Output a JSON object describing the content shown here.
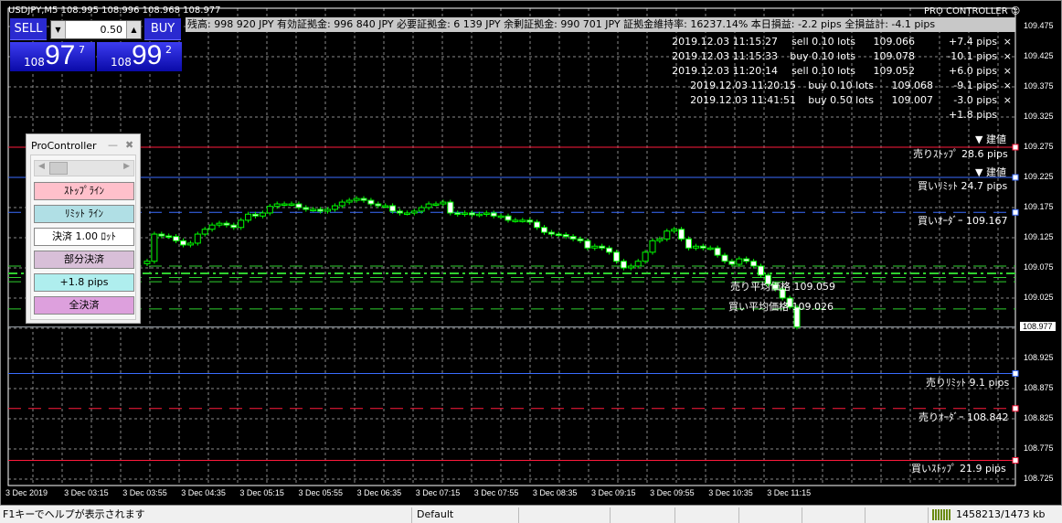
{
  "chart_header": {
    "symbol_line": "USDJPY,M5  108.995 108.996 108.968 108.977",
    "brand": "PRO CONTROLLER ☺"
  },
  "info_bar": "残高: 998 920 JPY   有効証拠金: 996 840 JPY   必要証拠金: 6 139 JPY   余剰証拠金: 990 701 JPY   証拠金維持率: 16237.14%   本日損益: -2.2 pips   全損益計: -4.1 pips",
  "trade_panel": {
    "sell_label": "SELL",
    "buy_label": "BUY",
    "lot": "0.50",
    "sell_price": {
      "prefix": "108",
      "main": "97",
      "sup": "7"
    },
    "buy_price": {
      "prefix": "108",
      "main": "99",
      "sup": "2"
    }
  },
  "positions": [
    {
      "time": "2019.12.03 11:15:27",
      "type": "sell 0.10 lots",
      "price": "109.066",
      "pips": "+7.4 pips",
      "close": "×"
    },
    {
      "time": "2019.12.03 11:15:33",
      "type": "buy 0.10 lots",
      "price": "109.078",
      "pips": "-10.1 pips",
      "close": "×"
    },
    {
      "time": "2019.12.03 11:20:14",
      "type": "sell 0.10 lots",
      "price": "109.052",
      "pips": "+6.0 pips",
      "close": "×"
    },
    {
      "time": "2019.12.03 11:20:15",
      "type": "buy 0.10 lots",
      "price": "109.068",
      "pips": "-9.1 pips",
      "close": "×"
    },
    {
      "time": "2019.12.03 11:41:51",
      "type": "buy 0.50 lots",
      "price": "109.007",
      "pips": "-3.0 pips",
      "close": "×"
    }
  ],
  "positions_total": "+1.8 pips",
  "procontroller": {
    "title": "ProController",
    "minimize": "—",
    "close": "✖",
    "buttons": [
      {
        "label": "ｽﾄｯﾌﾟﾗｲﾝ",
        "color": "#ffc0cb"
      },
      {
        "label": "ﾘﾐｯﾄ ﾗｲﾝ",
        "color": "#b0dfe5"
      },
      {
        "label": "決済 1.00 ﾛｯﾄ",
        "color": "#ffffff"
      },
      {
        "label": "部分決済",
        "color": "#d8bfd8"
      },
      {
        "label": "+1.8 pips",
        "color": "#afeeee"
      },
      {
        "label": "全決済",
        "color": "#dda0dd"
      }
    ]
  },
  "line_labels": {
    "entry1": "▼ 建値",
    "sell_stop": "売りｽﾄｯﾌﾟ 28.6 pips",
    "entry2": "▼ 建値",
    "buy_limit": "買いﾘﾐｯﾄ 24.7 pips",
    "buy_order": "買いｵｰﾀﾞｰ 109.167",
    "sell_avg": "売り平均価格 109.059",
    "buy_avg": "買い平均価格 109.026",
    "sell_limit": "売りﾘﾐｯﾄ 9.1 pips",
    "sell_order": "売りｵｰﾀﾞｰ 108.842",
    "buy_stop": "買いｽﾄｯﾌﾟ 21.9 pips"
  },
  "price_axis": [
    "109.475",
    "109.425",
    "109.375",
    "109.325",
    "109.275",
    "109.225",
    "109.175",
    "109.125",
    "109.075",
    "109.025",
    "108.975",
    "108.925",
    "108.875",
    "108.825",
    "108.775",
    "108.725"
  ],
  "current_price": "108.977",
  "time_axis": [
    "3 Dec 2019",
    "3 Dec 03:15",
    "3 Dec 03:55",
    "3 Dec 04:35",
    "3 Dec 05:15",
    "3 Dec 05:55",
    "3 Dec 06:35",
    "3 Dec 07:15",
    "3 Dec 07:55",
    "3 Dec 08:35",
    "3 Dec 09:15",
    "3 Dec 09:55",
    "3 Dec 10:35",
    "3 Dec 11:15"
  ],
  "status": {
    "help": "F1キーでヘルプが表示されます",
    "profile": "Default",
    "memory": "1458213/1473 kb"
  },
  "colors": {
    "bull": "#00ff00",
    "grid": "#a0a0a0",
    "stop": "#ff1a3c",
    "limit": "#3a6dff"
  },
  "chart_data": {
    "type": "candlestick",
    "closes": [
      109.086,
      109.131,
      109.128,
      109.127,
      109.12,
      109.113,
      109.116,
      109.131,
      109.139,
      109.146,
      109.149,
      109.146,
      109.142,
      109.154,
      109.164,
      109.161,
      109.166,
      109.177,
      109.181,
      109.181,
      109.181,
      109.175,
      109.172,
      109.172,
      109.169,
      109.172,
      109.178,
      109.184,
      109.187,
      109.19,
      109.187,
      109.181,
      109.178,
      109.178,
      109.169,
      109.166,
      109.166,
      109.169,
      109.175,
      109.181,
      109.181,
      109.184,
      109.166,
      109.164,
      109.166,
      109.163,
      109.164,
      109.166,
      109.161,
      109.161,
      109.154,
      109.154,
      109.154,
      109.151,
      109.142,
      109.134,
      109.131,
      109.13,
      109.127,
      109.123,
      109.12,
      109.108,
      109.111,
      109.108,
      109.101,
      109.086,
      109.075,
      109.078,
      109.086,
      109.101,
      109.12,
      109.123,
      109.136,
      109.139,
      109.123,
      109.108,
      109.111,
      109.108,
      109.108,
      109.096,
      109.086,
      109.081,
      109.09,
      109.086,
      109.078,
      109.063,
      109.048,
      109.04,
      109.025,
      109.01,
      108.977
    ],
    "levels": [
      {
        "price": 109.275,
        "color": "#ff1a3c",
        "style": "solid"
      },
      {
        "price": 109.225,
        "color": "#3a6dff",
        "style": "solid"
      },
      {
        "price": 109.167,
        "color": "#3a6dff",
        "style": "dash"
      },
      {
        "price": 109.078,
        "color": "#2fd02f",
        "style": "dash"
      },
      {
        "price": 109.066,
        "color": "#2fd02f",
        "style": "dashdot"
      },
      {
        "price": 109.059,
        "color": "#2fd02f",
        "style": "dash"
      },
      {
        "price": 109.052,
        "color": "#2fd02f",
        "style": "dash"
      },
      {
        "price": 109.007,
        "color": "#2fd02f",
        "style": "dash"
      },
      {
        "price": 108.977,
        "color": "#a0a8b0",
        "style": "solid"
      },
      {
        "price": 108.9,
        "color": "#3a6dff",
        "style": "solid"
      },
      {
        "price": 108.842,
        "color": "#ff1a3c",
        "style": "dash"
      },
      {
        "price": 108.756,
        "color": "#ff1a3c",
        "style": "solid"
      }
    ]
  }
}
